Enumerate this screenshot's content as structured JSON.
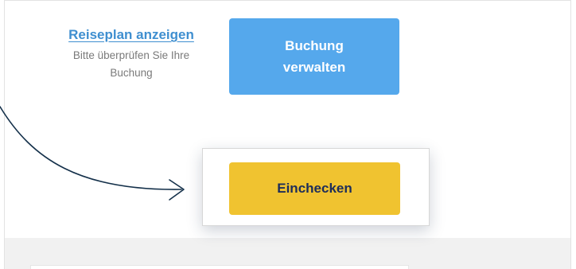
{
  "itinerary": {
    "link_label": "Reiseplan anzeigen",
    "help_text": "Bitte überprüfen Sie Ihre Buchung"
  },
  "manage_booking": {
    "label": "Buchung verwalten"
  },
  "checkin": {
    "label": "Einchecken"
  },
  "colors": {
    "link_blue": "#3f8fd0",
    "manage_button_blue": "#55a8ec",
    "checkin_button_yellow": "#f0c330",
    "checkin_text_navy": "#1d2d5a",
    "annotation_arrow": "#14304a"
  },
  "annotation": {
    "icon": "curved-arrow-icon"
  }
}
